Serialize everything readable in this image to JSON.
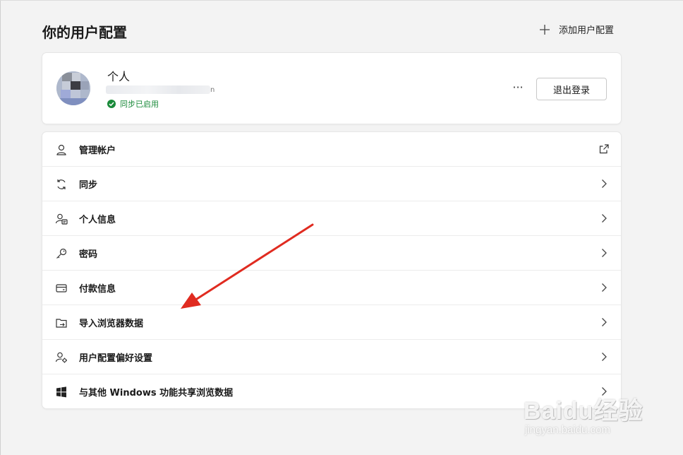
{
  "header": {
    "title": "你的用户配置",
    "add_profile_label": "添加用户配置"
  },
  "profile": {
    "name": "个人",
    "email_tail": "n",
    "sync_status": "同步已启用",
    "more_label": "···",
    "sign_out_label": "退出登录"
  },
  "menu": {
    "items": [
      {
        "label": "管理帐户",
        "icon": "person-icon",
        "trail": "external-link-icon"
      },
      {
        "label": "同步",
        "icon": "sync-icon",
        "trail": "chevron-right-icon"
      },
      {
        "label": "个人信息",
        "icon": "personal-info-icon",
        "trail": "chevron-right-icon"
      },
      {
        "label": "密码",
        "icon": "key-icon",
        "trail": "chevron-right-icon"
      },
      {
        "label": "付款信息",
        "icon": "credit-card-icon",
        "trail": "chevron-right-icon"
      },
      {
        "label": "导入浏览器数据",
        "icon": "import-folder-icon",
        "trail": "chevron-right-icon"
      },
      {
        "label": "用户配置偏好设置",
        "icon": "profile-settings-icon",
        "trail": "chevron-right-icon"
      },
      {
        "label": "与其他 Windows 功能共享浏览数据",
        "icon": "windows-icon",
        "trail": "chevron-right-icon"
      }
    ]
  },
  "watermark": {
    "brand": "Baidu经验",
    "url": "jingyan.baidu.com"
  },
  "colors": {
    "sync_green": "#1a8a3a",
    "annotation_red": "#e02b20",
    "background": "#f3f3f3"
  }
}
